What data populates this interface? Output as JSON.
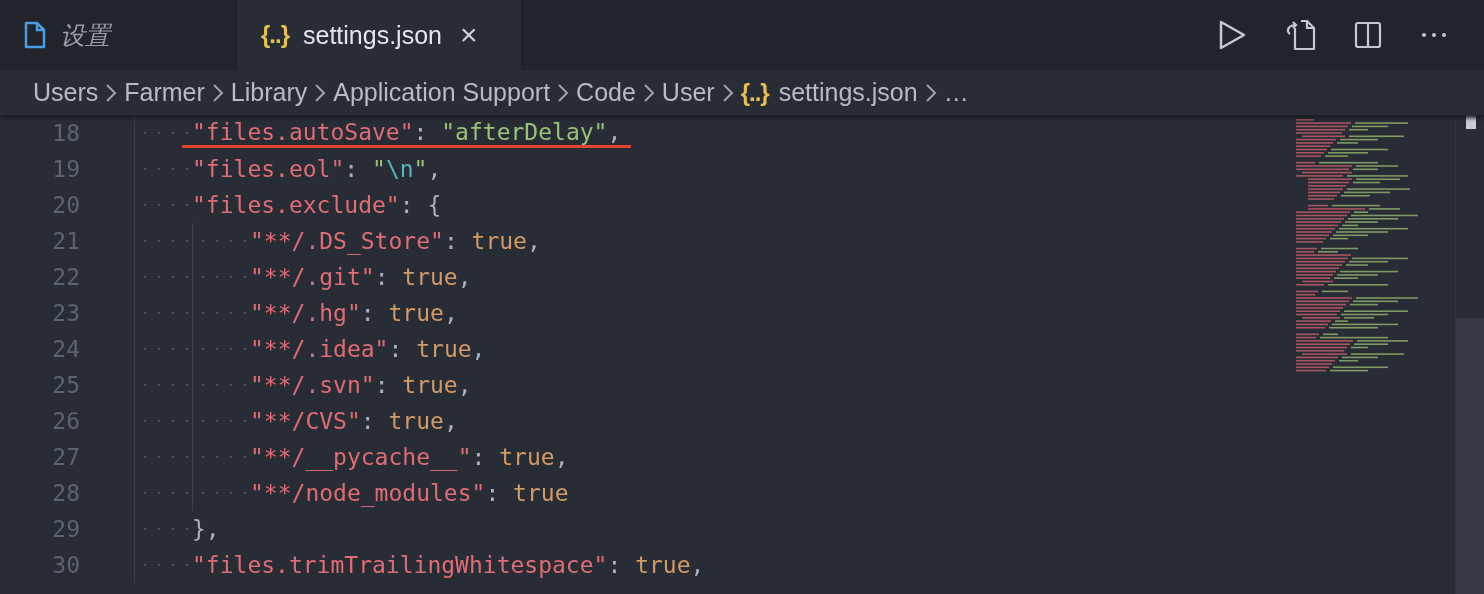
{
  "tabs": [
    {
      "label": "设置",
      "preview": true,
      "selected": false
    },
    {
      "label": "settings.json",
      "glyph": "{..}",
      "preview": false,
      "selected": true,
      "close": "×"
    }
  ],
  "breadcrumbs": [
    {
      "label": "Users"
    },
    {
      "label": "Farmer"
    },
    {
      "label": "Library"
    },
    {
      "label": "Application Support"
    },
    {
      "label": "Code"
    },
    {
      "label": "User"
    },
    {
      "label": "settings.json",
      "glyph": "{..}"
    },
    {
      "label": "…"
    }
  ],
  "lines": [
    {
      "number": "18",
      "underlined": true,
      "tokens": [
        {
          "kind": "key",
          "text": "\"files.autoSave\""
        },
        {
          "kind": "punct",
          "text": ": "
        },
        {
          "kind": "string",
          "text": "\"afterDelay\""
        },
        {
          "kind": "punct",
          "text": ","
        }
      ]
    },
    {
      "number": "19",
      "underlined": false,
      "tokens": [
        {
          "kind": "key",
          "text": "\"files.eol\""
        },
        {
          "kind": "punct",
          "text": ": "
        },
        {
          "kind": "string",
          "text": "\""
        },
        {
          "kind": "escape",
          "text": "\\n"
        },
        {
          "kind": "string",
          "text": "\""
        },
        {
          "kind": "punct",
          "text": ","
        }
      ]
    },
    {
      "number": "20",
      "underlined": false,
      "tokens": [
        {
          "kind": "key",
          "text": "\"files.exclude\""
        },
        {
          "kind": "punct",
          "text": ": {"
        }
      ],
      "children": [
        {
          "number": "21",
          "underlined": false,
          "tokens": [
            {
              "kind": "key",
              "text": "\"**/.DS_Store\""
            },
            {
              "kind": "punct",
              "text": ": "
            },
            {
              "kind": "bool",
              "text": "true"
            },
            {
              "kind": "punct",
              "text": ","
            }
          ]
        },
        {
          "number": "22",
          "underlined": false,
          "tokens": [
            {
              "kind": "key",
              "text": "\"**/.git\""
            },
            {
              "kind": "punct",
              "text": ": "
            },
            {
              "kind": "bool",
              "text": "true"
            },
            {
              "kind": "punct",
              "text": ","
            }
          ]
        },
        {
          "number": "23",
          "underlined": false,
          "tokens": [
            {
              "kind": "key",
              "text": "\"**/.hg\""
            },
            {
              "kind": "punct",
              "text": ": "
            },
            {
              "kind": "bool",
              "text": "true"
            },
            {
              "kind": "punct",
              "text": ","
            }
          ]
        },
        {
          "number": "24",
          "underlined": false,
          "tokens": [
            {
              "kind": "key",
              "text": "\"**/.idea\""
            },
            {
              "kind": "punct",
              "text": ": "
            },
            {
              "kind": "bool",
              "text": "true"
            },
            {
              "kind": "punct",
              "text": ","
            }
          ]
        },
        {
          "number": "25",
          "underlined": false,
          "tokens": [
            {
              "kind": "key",
              "text": "\"**/.svn\""
            },
            {
              "kind": "punct",
              "text": ": "
            },
            {
              "kind": "bool",
              "text": "true"
            },
            {
              "kind": "punct",
              "text": ","
            }
          ]
        },
        {
          "number": "26",
          "underlined": false,
          "tokens": [
            {
              "kind": "key",
              "text": "\"**/CVS\""
            },
            {
              "kind": "punct",
              "text": ": "
            },
            {
              "kind": "bool",
              "text": "true"
            },
            {
              "kind": "punct",
              "text": ","
            }
          ]
        },
        {
          "number": "27",
          "underlined": false,
          "tokens": [
            {
              "kind": "key",
              "text": "\"**/__pycache__\""
            },
            {
              "kind": "punct",
              "text": ": "
            },
            {
              "kind": "bool",
              "text": "true"
            },
            {
              "kind": "punct",
              "text": ","
            }
          ]
        },
        {
          "number": "28",
          "underlined": false,
          "tokens": [
            {
              "kind": "key",
              "text": "\"**/node_modules\""
            },
            {
              "kind": "punct",
              "text": ": "
            },
            {
              "kind": "bool",
              "text": "true"
            }
          ]
        }
      ]
    },
    {
      "number": "29",
      "underlined": false,
      "tokens": [
        {
          "kind": "punct",
          "text": "},"
        }
      ]
    },
    {
      "number": "30",
      "underlined": false,
      "tokens": [
        {
          "kind": "key",
          "text": "\"files.trimTrailingWhitespace\""
        },
        {
          "kind": "punct",
          "text": ": "
        },
        {
          "kind": "bool",
          "text": "true"
        },
        {
          "kind": "punct",
          "text": ","
        }
      ]
    }
  ]
}
